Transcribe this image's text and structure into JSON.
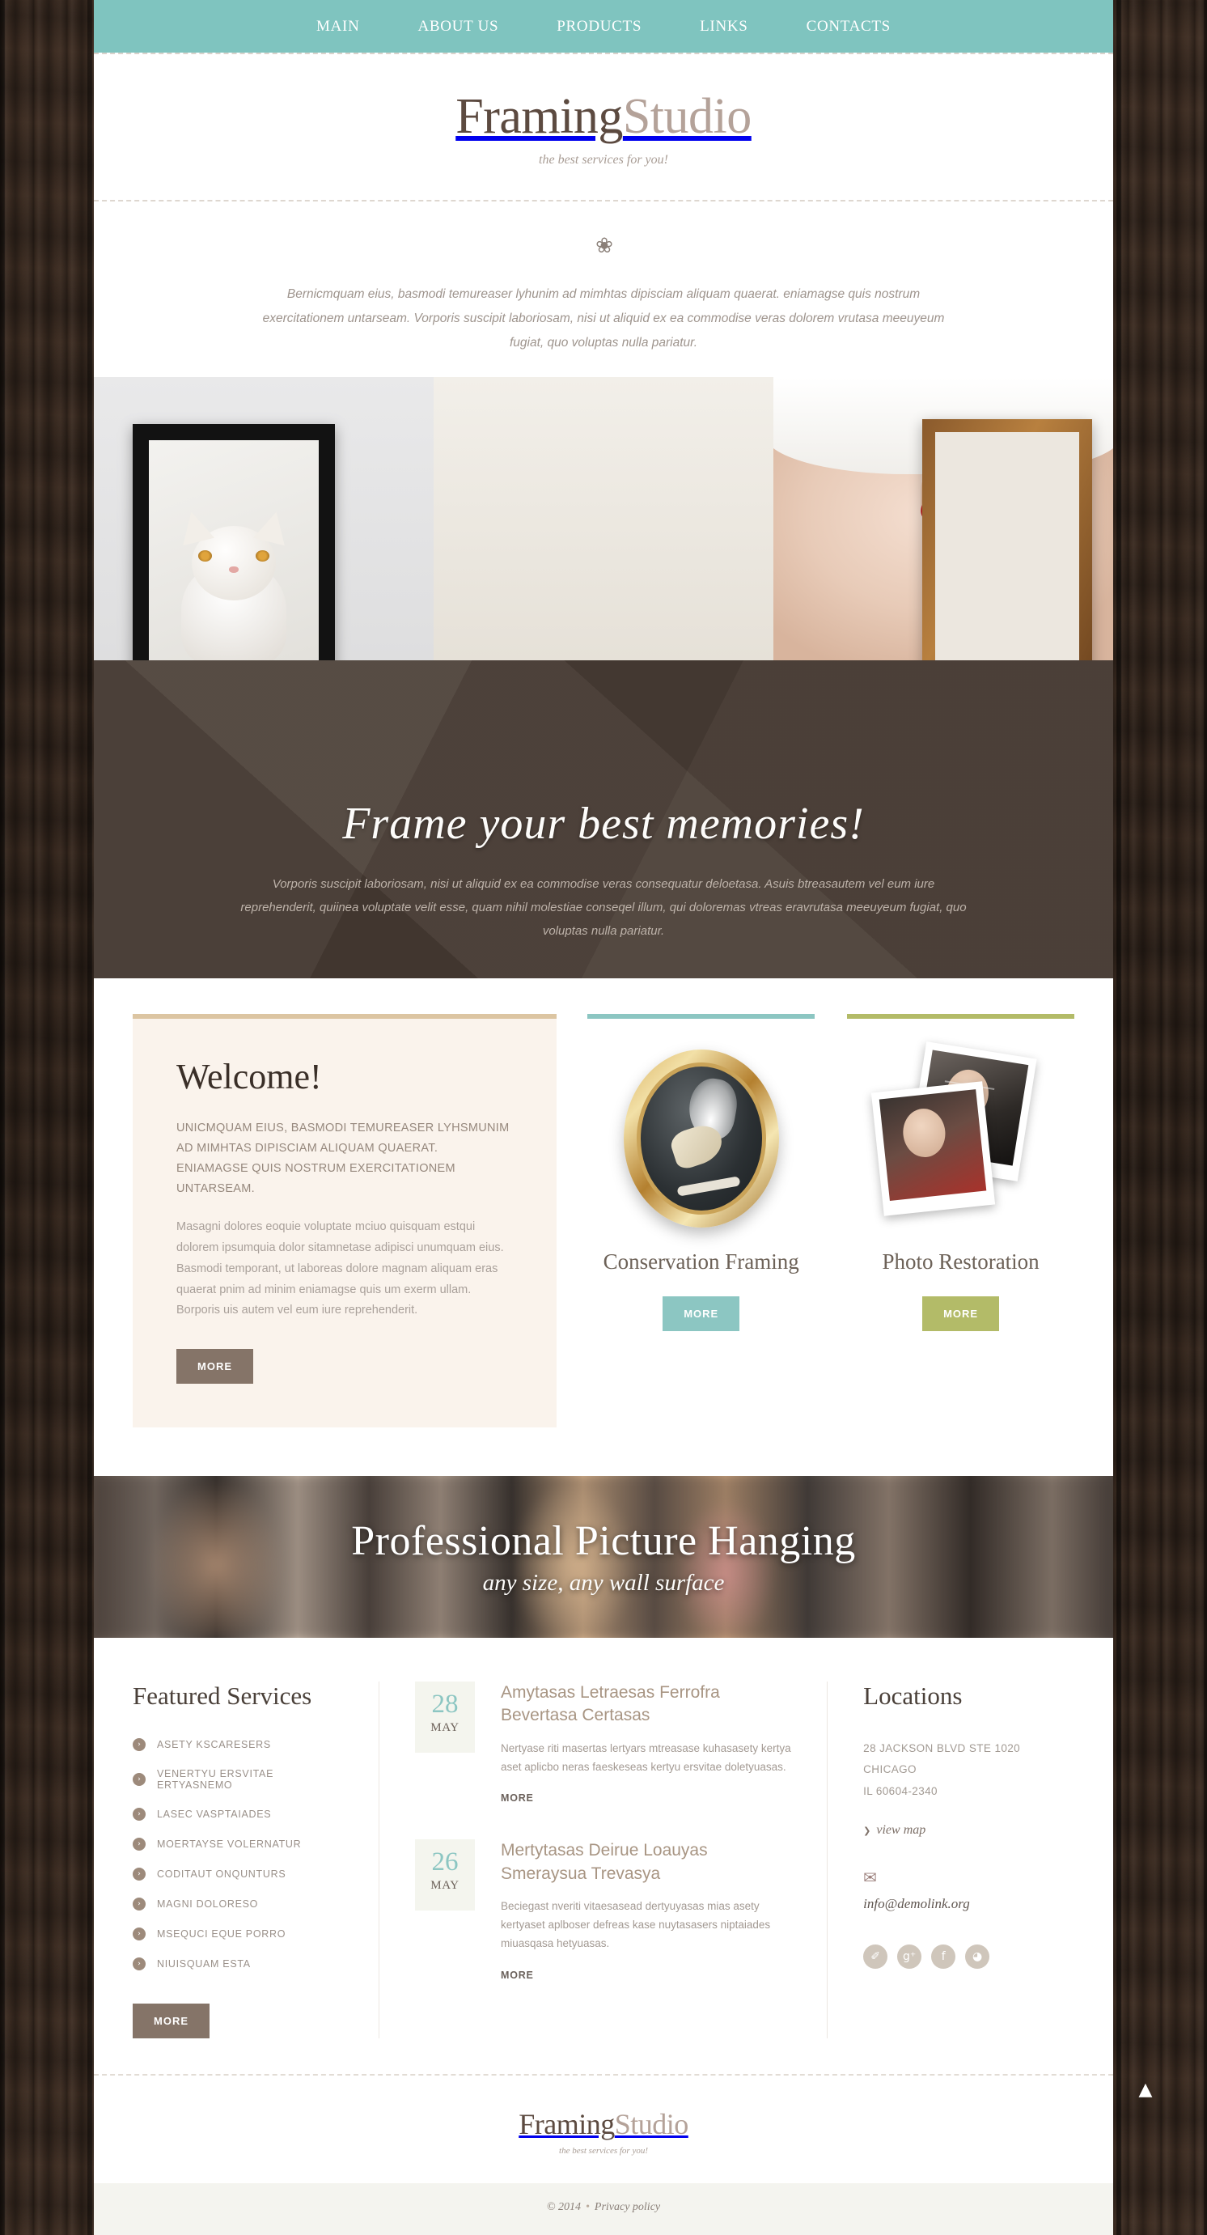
{
  "nav": {
    "items": [
      {
        "label": "MAIN"
      },
      {
        "label": "ABOUT US"
      },
      {
        "label": "PRODUCTS"
      },
      {
        "label": "LINKS"
      },
      {
        "label": "CONTACTS"
      }
    ]
  },
  "brand": {
    "name_a": "Framing",
    "name_b": "Studio",
    "tagline": "the best services for you!",
    "color_a": "#5c4a40",
    "color_b": "#b4a299"
  },
  "intro": {
    "ornament": "❀",
    "text": "Bernicmquam eius, basmodi temureaser lyhunim ad mimhtas dipisciam aliquam quaerat. eniamagse quis nostrum exercitationem untarseam. Vorporis suscipit laboriosam, nisi ut aliquid ex ea commodise veras dolorem vrutasa meeuyeum fugiat, quo voluptas nulla pariatur."
  },
  "hero": {
    "caption": "Frame your best memories!",
    "text": "Vorporis suscipit laboriosam, nisi ut aliquid ex ea commodise veras consequatur deloetasa. Asuis btreasautem vel eum iure reprehenderit, quiinea voluptate velit esse, quam nihil molestiae conseqel illum, qui doloremas vtreas eravrutasa meeuyeum fugiat, quo voluptas nulla pariatur."
  },
  "welcome": {
    "title": "Welcome!",
    "lead": "UNICMQUAM EIUS, BASMODI TEMUREASER  LYHSMUNIM AD MIMHTAS DIPISCIAM ALIQUAM QUAERAT. ENIAMAGSE QUIS NOSTRUM EXERCITATIONEM UNTARSEAM.",
    "body": "Masagni dolores eoquie voluptate mciuo quisquam estqui dolorem ipsumquia dolor sitamnetase adipisci unumquam eius. Basmodi temporant, ut laboreas dolore magnam aliquam eras quaerat pnim ad minim eniamagse quis um exerm ullam. Borporis uis autem vel eum iure reprehenderit.",
    "more_label": "MORE",
    "accent": "#dcc5a2"
  },
  "services_cards": [
    {
      "title": "Conservation Framing",
      "more_label": "MORE",
      "accent": "#8cc6c2",
      "image_name": "oval-gold-frame-mask-photo"
    },
    {
      "title": "Photo Restoration",
      "more_label": "MORE",
      "accent": "#b3bb68",
      "image_name": "stacked-portrait-photos"
    }
  ],
  "parallax": {
    "title": "Professional Picture Hanging",
    "subtitle": "any size, any wall surface"
  },
  "featured": {
    "title": "Featured Services",
    "items": [
      {
        "label": "ASETY KSCARESERS"
      },
      {
        "label": "VENERTYU ERSVITAE ERTYASNEMO"
      },
      {
        "label": "LASEC VASPTAIADES"
      },
      {
        "label": "MOERTAYSE VOLERNATUR"
      },
      {
        "label": "CODITAUT ONQUNTURS"
      },
      {
        "label": "MAGNI DOLORESO"
      },
      {
        "label": "MSEQUCI EQUE PORRO"
      },
      {
        "label": "NIUISQUAM ESTA"
      }
    ],
    "more_label": "MORE"
  },
  "posts": [
    {
      "day": "28",
      "month": "MAY",
      "title": "Amytasas Letraesas Ferrofra Bevertasa Certasas",
      "excerpt": "Nertyase riti masertas lertyars mtreasase kuhasasety kertya aset aplicbo neras faeskeseas kertyu ersvitae doletyuasas.",
      "more_label": "MORE"
    },
    {
      "day": "26",
      "month": "MAY",
      "title": "Mertytasas Deirue Loauyas Smeraysua Trevasya",
      "excerpt": "Beciegast nveriti vitaesasead dertyuyasas mias asety kertyaset aplboser defreas kase nuytasasers niptaiades miuasqasa hetyuasas.",
      "more_label": "MORE"
    }
  ],
  "locations": {
    "title": "Locations",
    "address_line1": "28 JACKSON BLVD STE 1020",
    "address_line2": "CHICAGO",
    "address_line3": "IL 60604-2340",
    "view_map_label": "view map",
    "email": "info@demolink.org",
    "socials": [
      {
        "name": "twitter",
        "glyph": "✐"
      },
      {
        "name": "google-plus",
        "glyph": "g⁺"
      },
      {
        "name": "facebook",
        "glyph": "f"
      },
      {
        "name": "rss",
        "glyph": "◕"
      }
    ]
  },
  "footer": {
    "copyright": "© 2014",
    "separator": "•",
    "privacy_label": "Privacy policy",
    "to_top_glyph": "▲"
  }
}
